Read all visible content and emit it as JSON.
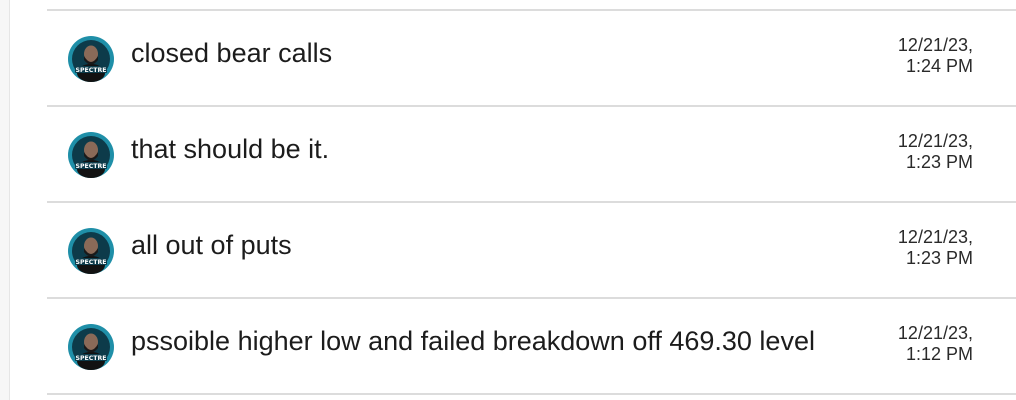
{
  "messages": [
    {
      "text": "closed bear calls",
      "date": "12/21/23,",
      "time": "1:24 PM",
      "avatar_label": "SPECTRE"
    },
    {
      "text": "that should be it.",
      "date": "12/21/23,",
      "time": "1:23 PM",
      "avatar_label": "SPECTRE"
    },
    {
      "text": "all out of puts",
      "date": "12/21/23,",
      "time": "1:23 PM",
      "avatar_label": "SPECTRE"
    },
    {
      "text": "pssoible higher low and failed breakdown off 469.30 level",
      "date": "12/21/23,",
      "time": "1:12 PM",
      "avatar_label": "SPECTRE"
    }
  ],
  "colors": {
    "avatar_ring": "#1f8fa8",
    "avatar_bg": "#0d3b4a",
    "divider": "#dcdcdc"
  },
  "icons": {
    "avatar": "spectre-avatar-icon"
  }
}
